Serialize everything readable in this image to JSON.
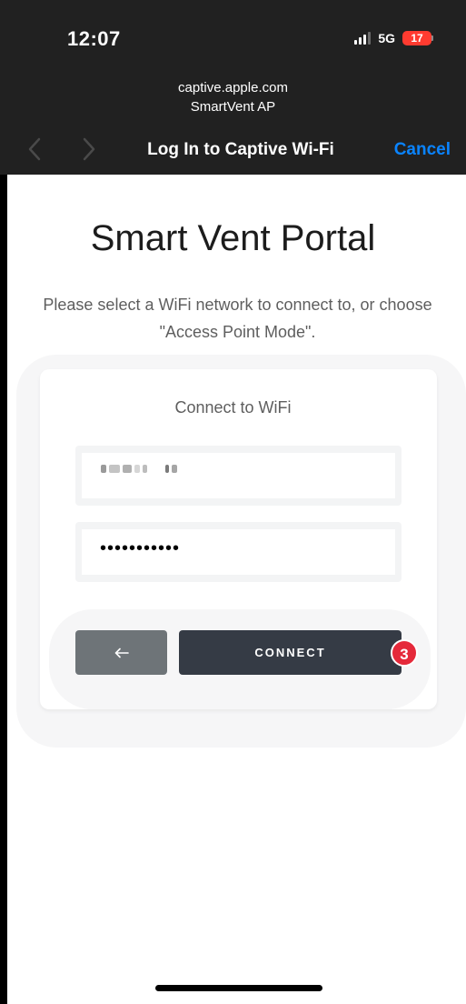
{
  "status_bar": {
    "time": "12:07",
    "network": "5G",
    "battery": "17"
  },
  "captive_header": {
    "url": "captive.apple.com",
    "network_name": "SmartVent AP",
    "title": "Log In to Captive Wi-Fi",
    "cancel_label": "Cancel",
    "back_icon": "chevron-left-icon",
    "forward_icon": "chevron-right-icon"
  },
  "portal": {
    "title": "Smart Vent Portal",
    "instruction": "Please select a WiFi network to connect to, or choose \"Access Point Mode\".",
    "form": {
      "heading": "Connect to WiFi",
      "ssid_value": "",
      "password_value": "•••••••••••",
      "back_icon": "arrow-left-icon",
      "connect_label": "CONNECT"
    },
    "step_badge": "3"
  },
  "colors": {
    "header_bg": "#212121",
    "cancel_blue": "#0a84ff",
    "connect_bg": "#353b45",
    "back_bg": "#6e7478",
    "badge_red": "#e5293a",
    "battery_red": "#ff3b30"
  }
}
